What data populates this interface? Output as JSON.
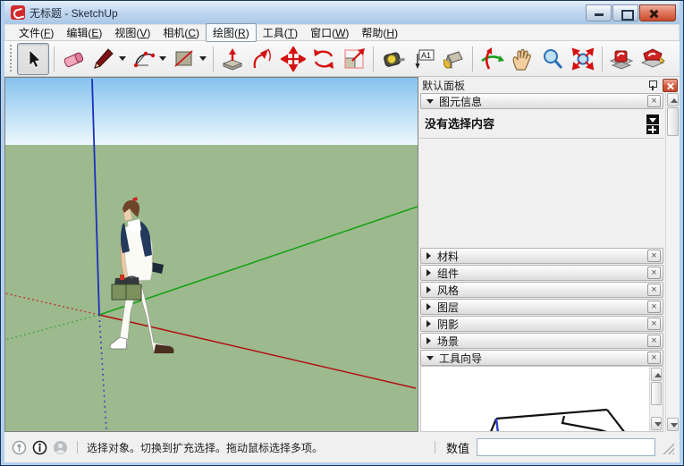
{
  "window": {
    "title": "无标题 - SketchUp"
  },
  "menu": {
    "items": [
      {
        "pre": "文件(",
        "key": "F",
        "post": ")"
      },
      {
        "pre": "编辑(",
        "key": "E",
        "post": ")"
      },
      {
        "pre": "视图(",
        "key": "V",
        "post": ")"
      },
      {
        "pre": "相机(",
        "key": "C",
        "post": ")"
      },
      {
        "pre": "绘图(",
        "key": "R",
        "post": ")"
      },
      {
        "pre": "工具(",
        "key": "T",
        "post": ")"
      },
      {
        "pre": "窗口(",
        "key": "W",
        "post": ")"
      },
      {
        "pre": "帮助(",
        "key": "H",
        "post": ")"
      }
    ],
    "active_item": "绘图(R)"
  },
  "toolbar": {
    "tools": [
      "select",
      "eraser",
      "line",
      "arc",
      "rectangle",
      "push-pull",
      "follow-me",
      "move",
      "rotate",
      "scale",
      "tape-measure",
      "text",
      "paint-bucket",
      "orbit",
      "pan",
      "zoom",
      "zoom-extents",
      "get-models",
      "share-model"
    ],
    "active_tool": "select"
  },
  "panel": {
    "title": "默认面板",
    "entity_info": {
      "label": "图元信息",
      "empty_text": "没有选择内容"
    },
    "sections": [
      {
        "label": "材料"
      },
      {
        "label": "组件"
      },
      {
        "label": "风格"
      },
      {
        "label": "图层"
      },
      {
        "label": "阴影"
      },
      {
        "label": "场景"
      },
      {
        "label": "工具向导"
      }
    ]
  },
  "statusbar": {
    "hint": "选择对象。切换到扩充选择。拖动鼠标选择多项。",
    "measure_label": "数值",
    "measure_value": ""
  },
  "colors": {
    "titlebar": "#bdd4ee",
    "close_button": "#c94b2d",
    "sky_top": "#85c2ee",
    "sky_bottom": "#eef7fc",
    "ground": "#9cba8e",
    "axis_red": "#b01111",
    "axis_green": "#12a112",
    "axis_blue": "#1b2fbd"
  }
}
